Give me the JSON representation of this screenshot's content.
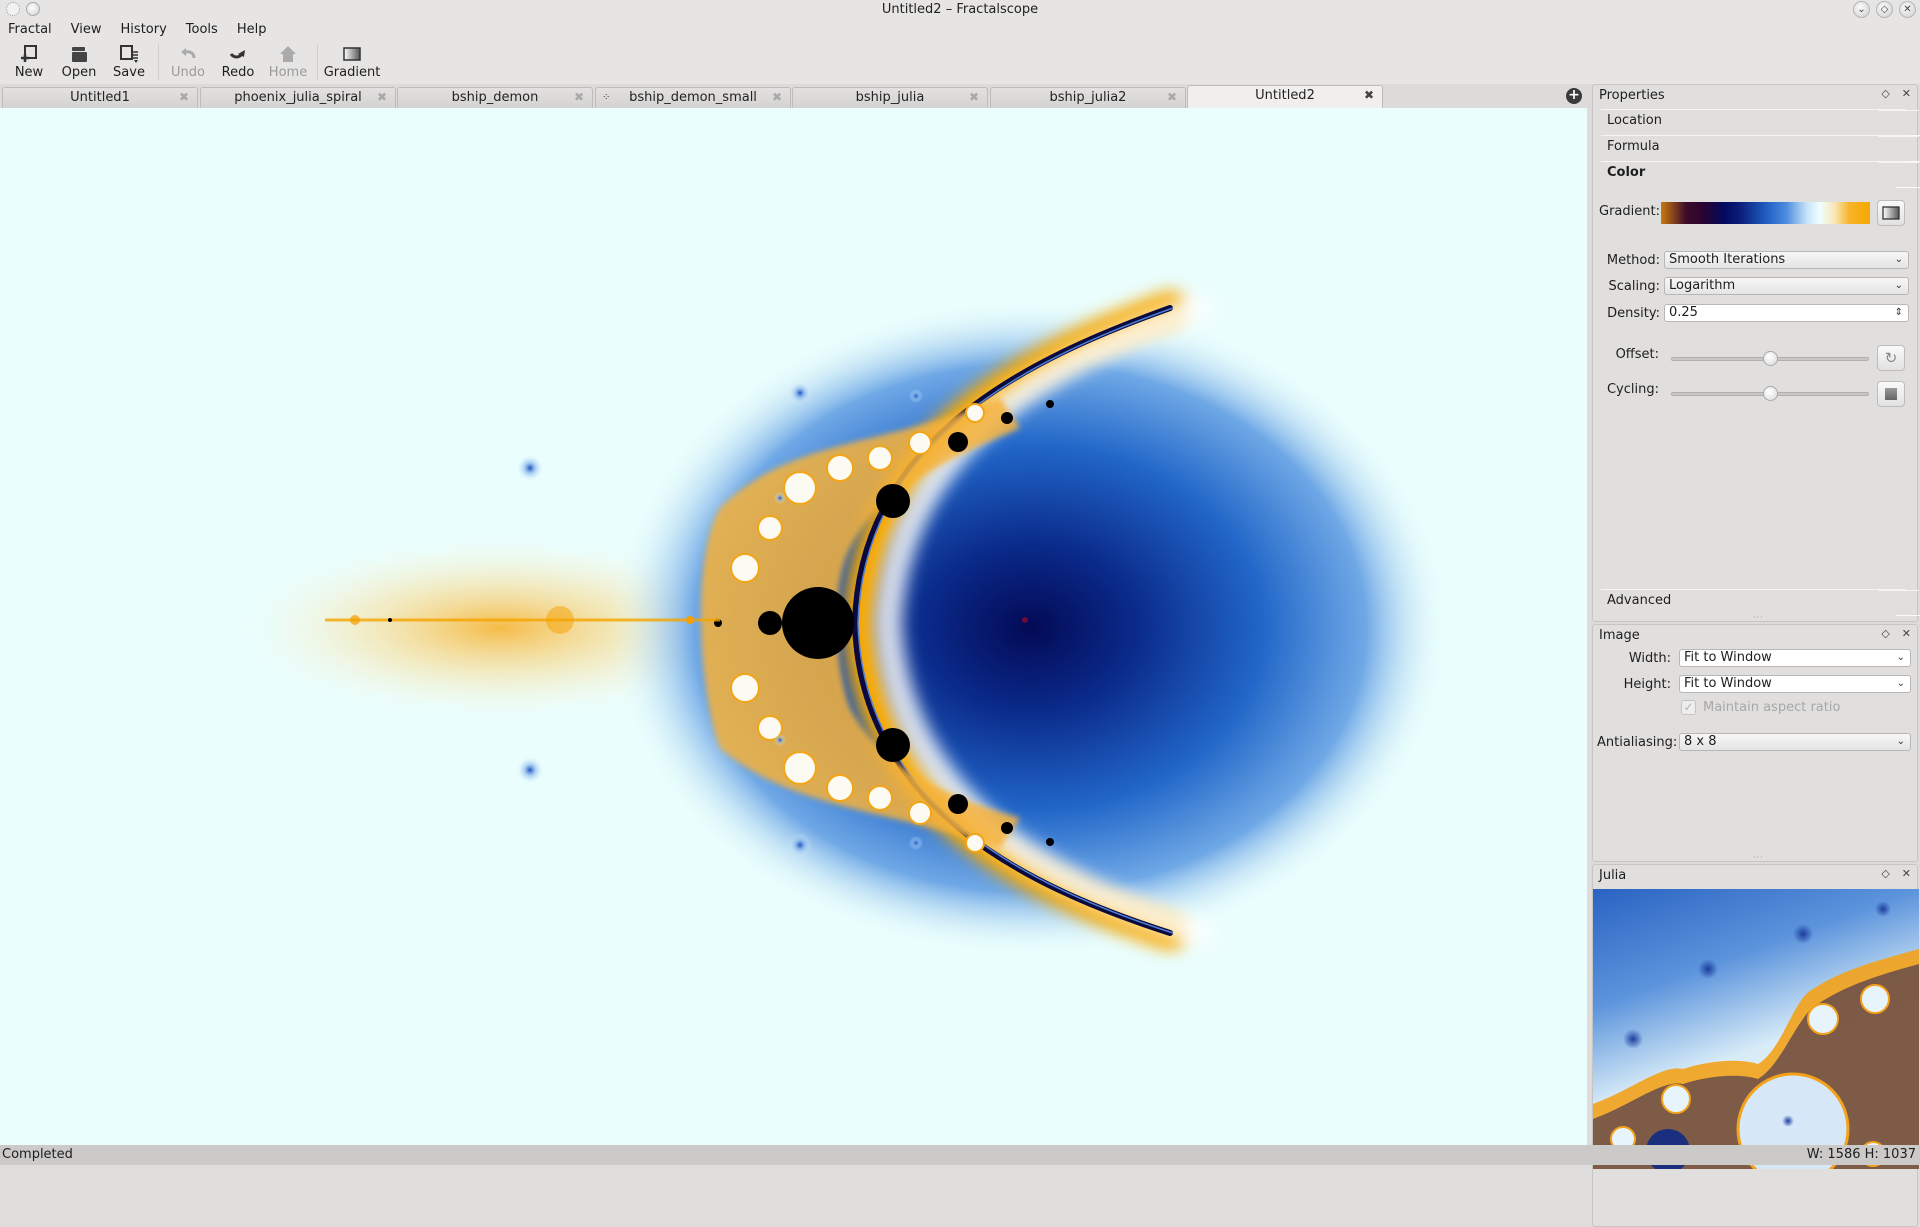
{
  "window": {
    "title": "Untitled2 – Fractalscope",
    "controls": [
      "minimize",
      "maximize",
      "close"
    ]
  },
  "menubar": {
    "items": [
      "Fractal",
      "View",
      "History",
      "Tools",
      "Help"
    ]
  },
  "toolbar": {
    "buttons": [
      {
        "label": "New",
        "icon": "new-document-icon",
        "enabled": true
      },
      {
        "label": "Open",
        "icon": "folder-icon",
        "enabled": true
      },
      {
        "label": "Save",
        "icon": "save-icon",
        "enabled": true
      },
      {
        "label": "Undo",
        "icon": "undo-icon",
        "enabled": false
      },
      {
        "label": "Redo",
        "icon": "redo-icon",
        "enabled": true
      },
      {
        "label": "Home",
        "icon": "home-icon",
        "enabled": false
      },
      {
        "label": "Gradient",
        "icon": "gradient-icon",
        "enabled": true
      }
    ]
  },
  "tabs": [
    {
      "label": "Untitled1",
      "active": false
    },
    {
      "label": "phoenix_julia_spiral",
      "active": false
    },
    {
      "label": "bship_demon",
      "active": false
    },
    {
      "label": "bship_demon_small",
      "active": false,
      "busy_icon": true
    },
    {
      "label": "bship_julia",
      "active": false
    },
    {
      "label": "bship_julia2",
      "active": false
    },
    {
      "label": "Untitled2",
      "active": true
    }
  ],
  "properties": {
    "title": "Properties",
    "sections": {
      "location": "Location",
      "formula": "Formula",
      "color": "Color",
      "advanced": "Advanced"
    },
    "color": {
      "gradient_label": "Gradient:",
      "gradient_stops": [
        "#c97a10",
        "#2a0430",
        "#03095e",
        "#1f5cc0",
        "#effeff",
        "#f5a800"
      ],
      "method_label": "Method:",
      "method_value": "Smooth Iterations",
      "scaling_label": "Scaling:",
      "scaling_value": "Logarithm",
      "density_label": "Density:",
      "density_value": "0.25",
      "offset_label": "Offset:",
      "offset_fraction": 0.5,
      "cycling_label": "Cycling:",
      "cycling_fraction": 0.5
    }
  },
  "image": {
    "title": "Image",
    "width_label": "Width:",
    "width_value": "Fit to Window",
    "height_label": "Height:",
    "height_value": "Fit to Window",
    "aspect_label": "Maintain aspect ratio",
    "aspect_checked": true,
    "antialiasing_label": "Antialiasing:",
    "antialiasing_value": "8 x 8"
  },
  "julia": {
    "title": "Julia"
  },
  "status": {
    "text": "Completed",
    "dimensions": "W: 1586  H: 1037"
  }
}
